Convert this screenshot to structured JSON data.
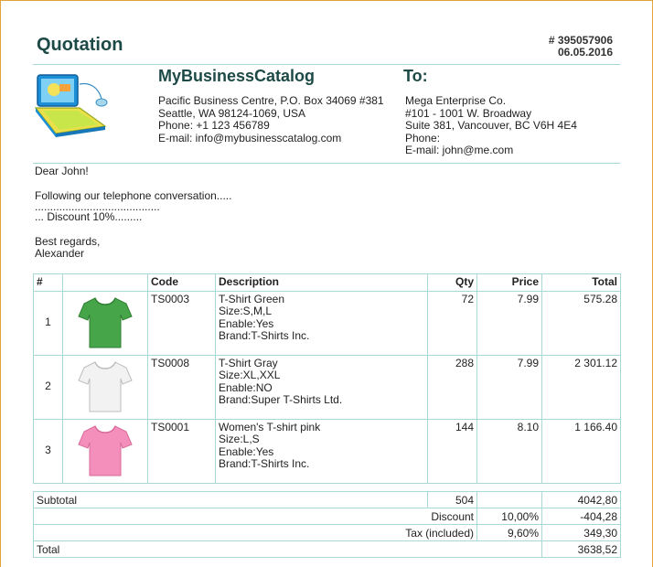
{
  "doc": {
    "title": "Quotation",
    "number": "# 395057906",
    "date": "06.05.2016"
  },
  "seller": {
    "name": "MyBusinessCatalog",
    "lines": [
      "Pacific Business Centre, P.O. Box 34069 #381",
      "Seattle, WA 98124-1069, USA",
      "Phone: +1 123 456789",
      "E-mail: info@mybusinesscatalog.com"
    ]
  },
  "buyer": {
    "heading": "To:",
    "lines": [
      "Mega Enterprise Co.",
      "#101 - 1001 W. Broadway",
      "Suite 381, Vancouver, BC V6H 4E4",
      "Phone:",
      "E-mail: john@me.com"
    ]
  },
  "letter": {
    "greeting": "Dear John!",
    "line1": "Following our telephone conversation.....",
    "line2": ".........................................",
    "line3": "... Discount 10%.........",
    "closing": "Best regards,",
    "signature": "Alexander"
  },
  "table": {
    "headers": {
      "num": "#",
      "code": "Code",
      "description": "Description",
      "qty": "Qty",
      "price": "Price",
      "total": "Total"
    },
    "rows": [
      {
        "num": "1",
        "code": "TS0003",
        "name": "T-Shirt Green",
        "size": "Size:S,M,L",
        "enable": "Enable:Yes",
        "brand": "Brand:T-Shirts Inc.",
        "qty": "72",
        "price": "7.99",
        "total": "575.28",
        "color": "#46a548",
        "shade": "#2f7f33"
      },
      {
        "num": "2",
        "code": "TS0008",
        "name": "T-Shirt Gray",
        "size": "Size:XL,XXL",
        "enable": "Enable:NO",
        "brand": "Brand:Super T-Shirts Ltd.",
        "qty": "288",
        "price": "7.99",
        "total": "2 301.12",
        "color": "#f2f2f2",
        "shade": "#bdbdbd"
      },
      {
        "num": "3",
        "code": "TS0001",
        "name": "Women's T-shirt pink",
        "size": "Size:L,S",
        "enable": "Enable:Yes",
        "brand": "Brand:T-Shirts Inc.",
        "qty": "144",
        "price": "8.10",
        "total": "1 166.40",
        "color": "#f38fba",
        "shade": "#d86a9a"
      }
    ]
  },
  "totals": {
    "subtotal_label": "Subtotal",
    "subtotal_qty": "504",
    "subtotal_value": "4042,80",
    "discount_label": "Discount",
    "discount_rate": "10,00%",
    "discount_value": "-404,28",
    "tax_label": "Tax (included)",
    "tax_rate": "9,60%",
    "tax_value": "349,30",
    "total_label": "Total",
    "total_value": "3638,52"
  },
  "icons": {
    "logo": "laptop-logo-icon",
    "product": "tshirt-icon"
  }
}
